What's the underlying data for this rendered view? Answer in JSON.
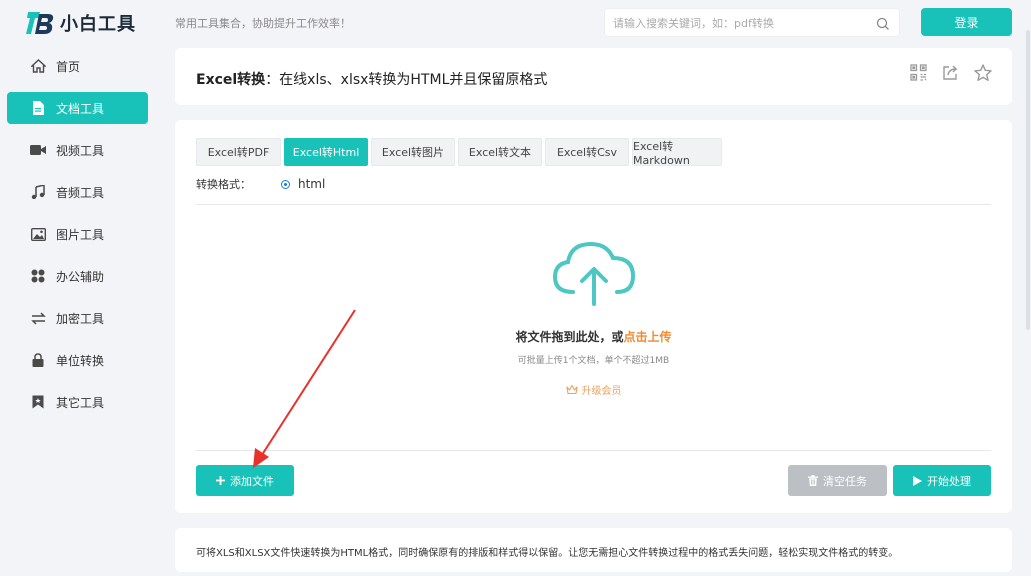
{
  "app": {
    "logo_text": "小白工具",
    "slogan": "常用工具集合，协助提升工作效率！"
  },
  "search": {
    "placeholder": "请输入搜索关键词，如：pdf转换",
    "icon": "search-icon"
  },
  "header": {
    "login_label": "登录"
  },
  "sidebar": {
    "items": [
      {
        "label": "首页",
        "icon": "home-icon",
        "active": false
      },
      {
        "label": "文档工具",
        "icon": "document-icon",
        "active": true
      },
      {
        "label": "视频工具",
        "icon": "video-icon",
        "active": false
      },
      {
        "label": "音频工具",
        "icon": "music-icon",
        "active": false
      },
      {
        "label": "图片工具",
        "icon": "image-icon",
        "active": false
      },
      {
        "label": "办公辅助",
        "icon": "apps-icon",
        "active": false
      },
      {
        "label": "加密工具",
        "icon": "swap-icon",
        "active": false
      },
      {
        "label": "单位转换",
        "icon": "lock-icon",
        "active": false
      },
      {
        "label": "其它工具",
        "icon": "bookmark-icon",
        "active": false
      }
    ]
  },
  "title_card": {
    "title_bold": "Excel转换",
    "title_rest": "：在线xls、xlsx转换为HTML并且保留原格式",
    "icons": [
      "qrcode-icon",
      "share-icon",
      "star-icon"
    ]
  },
  "tool": {
    "tabs": [
      {
        "label": "Excel转PDF",
        "active": false
      },
      {
        "label": "Excel转Html",
        "active": true
      },
      {
        "label": "Excel转图片",
        "active": false
      },
      {
        "label": "Excel转文本",
        "active": false
      },
      {
        "label": "Excel转Csv",
        "active": false
      },
      {
        "label": "Excel转Markdown",
        "active": false
      }
    ],
    "format_label": "转换格式：",
    "format_value": "html",
    "drop_title_prefix": "将文件拖到此处，或",
    "drop_title_link": "点击上传",
    "drop_sub": "可批量上传1个文档，单个不超过1MB",
    "upgrade_label": "升级会员",
    "add_file_label": "添加文件",
    "clear_label": "清空任务",
    "start_label": "开始处理"
  },
  "description": {
    "text": "可将XLS和XLSX文件快速转换为HTML格式，同时确保原有的排版和样式得以保留。让您无需担心文件转换过程中的格式丢失问题，轻松实现文件格式的转变。"
  },
  "colors": {
    "accent": "#18c2b8",
    "link_orange": "#f08b2f",
    "annotation_red": "#e8312b"
  }
}
